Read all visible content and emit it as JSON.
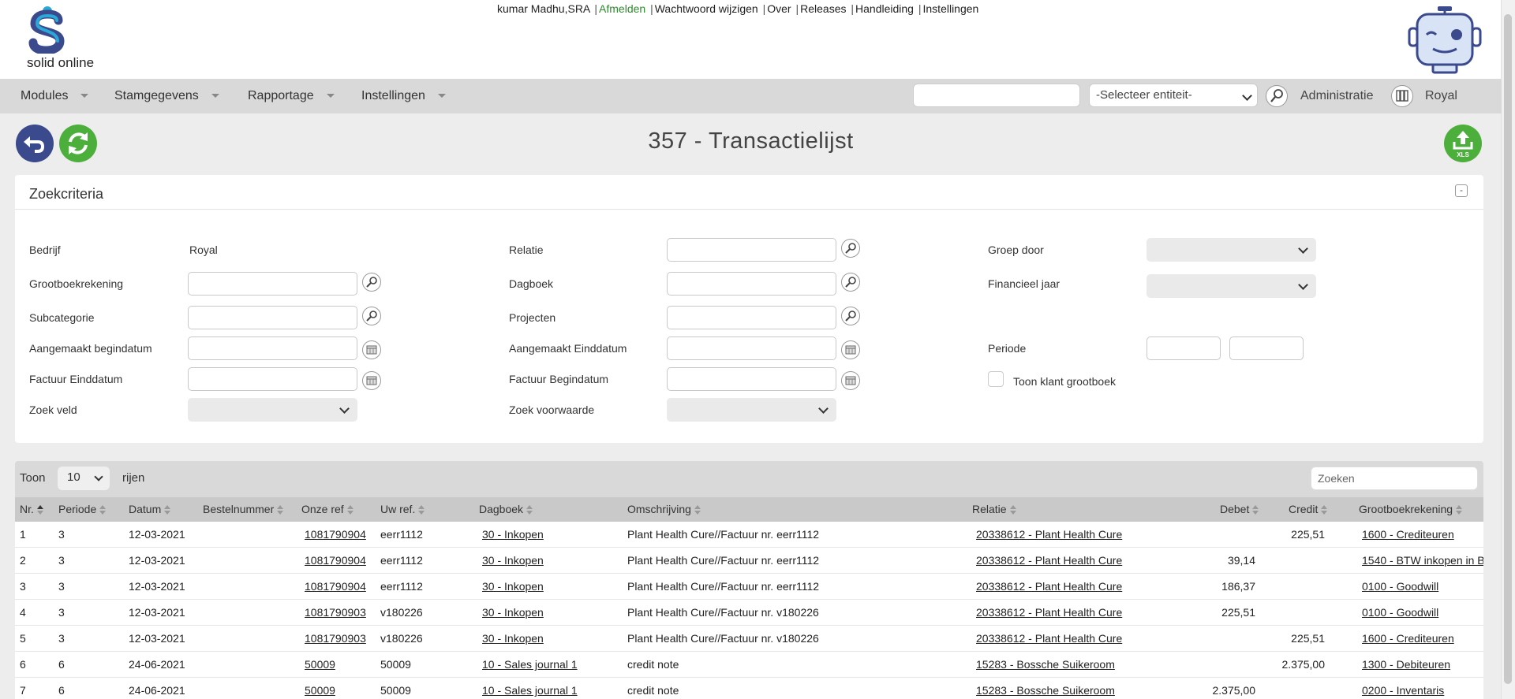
{
  "header": {
    "logo_text": "solid online",
    "user": "kumar Madhu,SRA",
    "links": [
      {
        "label": "Afmelden",
        "accent": "#2e8b2e"
      },
      {
        "label": "Wachtwoord wijzigen"
      },
      {
        "label": "Over"
      },
      {
        "label": "Releases"
      },
      {
        "label": "Handleiding"
      },
      {
        "label": "Instellingen"
      }
    ]
  },
  "menu": {
    "items": [
      "Modules",
      "Stamgegevens",
      "Rapportage",
      "Instellingen"
    ],
    "quick_search_placeholder": "",
    "entity_select": "-Selecteer entiteit-",
    "admin_label": "Administratie",
    "company_label": "Royal"
  },
  "page": {
    "title": "357 - Transactielijst"
  },
  "search_panel": {
    "title": "Zoekcriteria",
    "collapse_symbol": "-",
    "fields": {
      "bedrijf_label": "Bedrijf",
      "bedrijf_value": "Royal",
      "grootboek_label": "Grootboekrekening",
      "subcategorie_label": "Subcategorie",
      "aangemaakt_begin_label": "Aangemaakt begindatum",
      "factuur_eind_label": "Factuur Einddatum",
      "zoek_veld_label": "Zoek veld",
      "relatie_label": "Relatie",
      "dagboek_label": "Dagboek",
      "projecten_label": "Projecten",
      "aangemaakt_eind_label": "Aangemaakt Einddatum",
      "factuur_begin_label": "Factuur Begindatum",
      "zoek_voorwaarde_label": "Zoek voorwaarde",
      "groep_door_label": "Groep door",
      "financieel_jaar_label": "Financieel jaar",
      "periode_label": "Periode",
      "toon_klant_label": "Toon klant grootboek"
    }
  },
  "grid": {
    "length_prefix": "Toon",
    "length_value": "10",
    "length_suffix": "rijen",
    "search_placeholder": "Zoeken",
    "columns": [
      "Nr.",
      "Periode",
      "Datum",
      "Bestelnummer",
      "Onze ref",
      "Uw ref.",
      "Dagboek",
      "Omschrijving",
      "Relatie",
      "Debet",
      "Credit",
      "Grootboekrekening"
    ],
    "rows": [
      {
        "nr": "1",
        "periode": "3",
        "datum": "12-03-2021",
        "bestel": "",
        "onze_ref": "1081790904",
        "uw_ref": "eerr1112",
        "dagboek": "30 - Inkopen",
        "omschrijving": "Plant Health Cure//Factuur nr. eerr1112",
        "relatie": "20338612 - Plant Health Cure",
        "debet": "",
        "credit": "225,51",
        "grootboek": "1600 - Crediteuren"
      },
      {
        "nr": "2",
        "periode": "3",
        "datum": "12-03-2021",
        "bestel": "",
        "onze_ref": "1081790904",
        "uw_ref": "eerr1112",
        "dagboek": "30 - Inkopen",
        "omschrijving": "Plant Health Cure//Factuur nr. eerr1112",
        "relatie": "20338612 - Plant Health Cure",
        "debet": "39,14",
        "credit": "",
        "grootboek": "1540 - BTW inkopen in B"
      },
      {
        "nr": "3",
        "periode": "3",
        "datum": "12-03-2021",
        "bestel": "",
        "onze_ref": "1081790904",
        "uw_ref": "eerr1112",
        "dagboek": "30 - Inkopen",
        "omschrijving": "Plant Health Cure//Factuur nr. eerr1112",
        "relatie": "20338612 - Plant Health Cure",
        "debet": "186,37",
        "credit": "",
        "grootboek": "0100 - Goodwill"
      },
      {
        "nr": "4",
        "periode": "3",
        "datum": "12-03-2021",
        "bestel": "",
        "onze_ref": "1081790903",
        "uw_ref": "v180226",
        "dagboek": "30 - Inkopen",
        "omschrijving": "Plant Health Cure//Factuur nr. v180226",
        "relatie": "20338612 - Plant Health Cure",
        "debet": "225,51",
        "credit": "",
        "grootboek": "0100 - Goodwill"
      },
      {
        "nr": "5",
        "periode": "3",
        "datum": "12-03-2021",
        "bestel": "",
        "onze_ref": "1081790903",
        "uw_ref": "v180226",
        "dagboek": "30 - Inkopen",
        "omschrijving": "Plant Health Cure//Factuur nr. v180226",
        "relatie": "20338612 - Plant Health Cure",
        "debet": "",
        "credit": "225,51",
        "grootboek": "1600 - Crediteuren"
      },
      {
        "nr": "6",
        "periode": "6",
        "datum": "24-06-2021",
        "bestel": "",
        "onze_ref": "50009",
        "uw_ref": "50009",
        "dagboek": "10 - Sales journal 1",
        "omschrijving": "credit note",
        "relatie": "15283 - Bossche Suikeroom",
        "debet": "",
        "credit": "2.375,00",
        "grootboek": "1300 - Debiteuren"
      },
      {
        "nr": "7",
        "periode": "6",
        "datum": "24-06-2021",
        "bestel": "",
        "onze_ref": "50009",
        "uw_ref": "50009",
        "dagboek": "10 - Sales journal 1",
        "omschrijving": "credit note",
        "relatie": "15283 - Bossche Suikeroom",
        "debet": "2.375,00",
        "credit": "",
        "grootboek": "0200 - Inventaris"
      }
    ]
  },
  "colors": {
    "accent_green": "#4caf3c",
    "navy": "#3a4a8c",
    "menu_bg": "#d9d9d9"
  }
}
